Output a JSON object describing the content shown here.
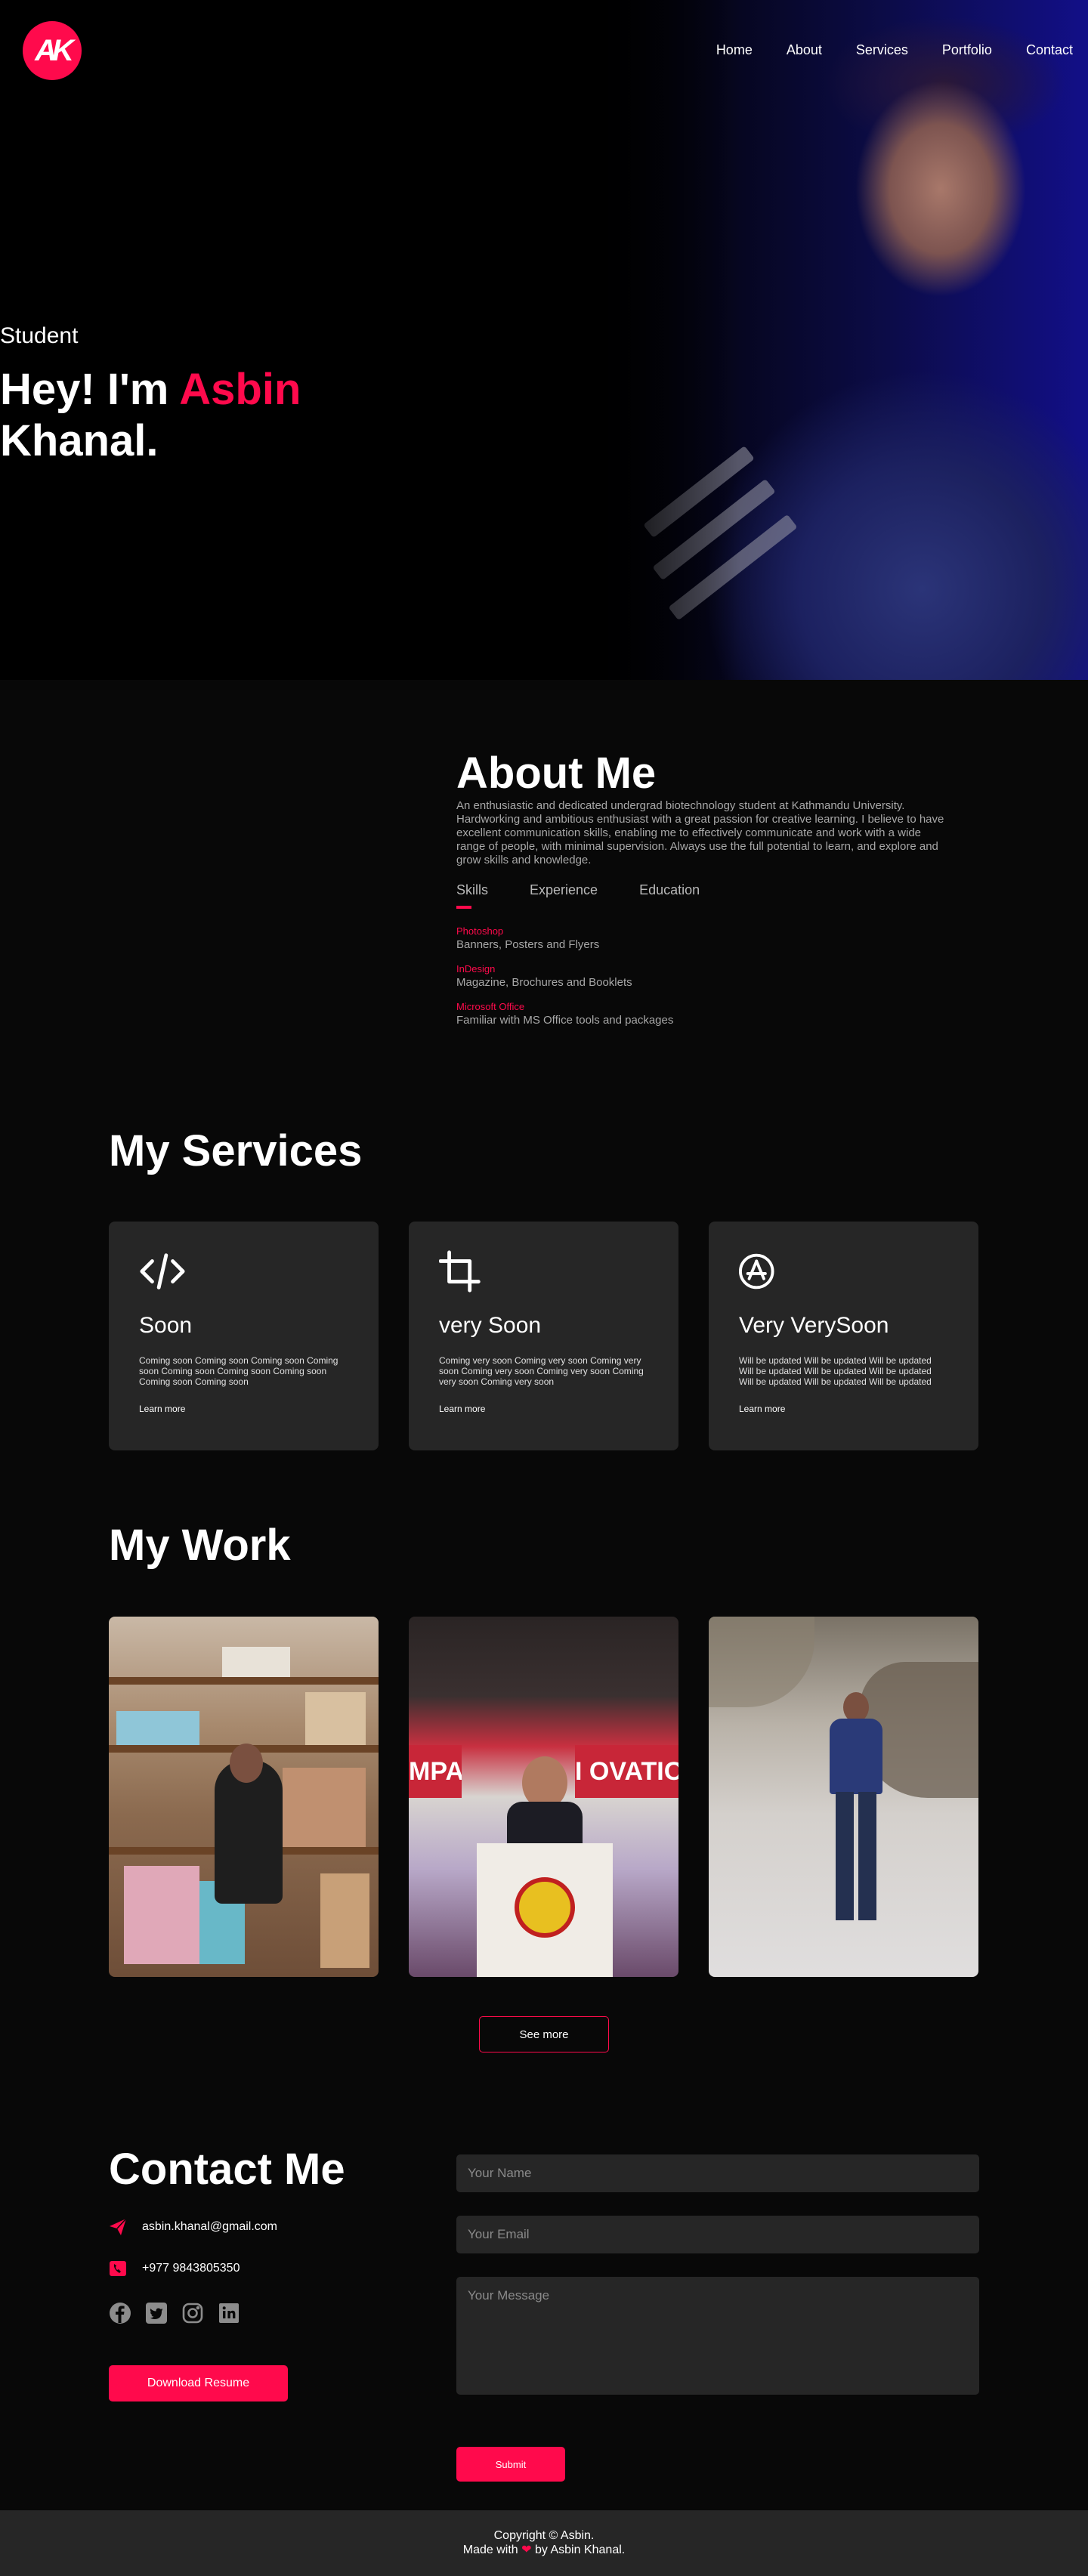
{
  "brand": {
    "logo_text": "AK",
    "accent": "#ff0a4c"
  },
  "nav": [
    {
      "label": "Home"
    },
    {
      "label": "About"
    },
    {
      "label": "Services"
    },
    {
      "label": "Portfolio"
    },
    {
      "label": "Contact"
    }
  ],
  "hero": {
    "subtitle": "Student",
    "greeting": "Hey! I'm",
    "first_name": "Asbin",
    "last_name": "Khanal."
  },
  "about": {
    "title": "About Me",
    "description": "An enthusiastic and dedicated undergrad biotechnology student at Kathmandu University. Hardworking and ambitious enthusiast with a great passion for creative learning. I believe to have excellent communication skills, enabling me to effectively communicate and work with a wide range of people, with minimal supervision. Always use the full potential to learn, and explore and grow skills and knowledge.",
    "tabs": [
      {
        "label": "Skills",
        "active": true
      },
      {
        "label": "Experience",
        "active": false
      },
      {
        "label": "Education",
        "active": false
      }
    ],
    "skills": [
      {
        "name": "Photoshop",
        "value": "Banners, Posters and Flyers"
      },
      {
        "name": "InDesign",
        "value": "Magazine, Brochures and Booklets"
      },
      {
        "name": "Microsoft Office",
        "value": "Familiar with MS Office tools and packages"
      }
    ]
  },
  "services": {
    "title": "My Services",
    "cards": [
      {
        "icon": "code-icon",
        "title": "Soon",
        "text": "Coming soon Coming soon Coming soon Coming soon Coming soon Coming soon Coming soon Coming soon Coming soon",
        "link": "Learn more"
      },
      {
        "icon": "crop-icon",
        "title": "very Soon",
        "text": "Coming very soon Coming very soon Coming very soon Coming very soon Coming very soon Coming very soon Coming very soon",
        "link": "Learn more"
      },
      {
        "icon": "app-store-icon",
        "title": "Very VerySoon",
        "text": "Will be updated Will be updated Will be updated Will be updated Will be updated Will be updated Will be updated Will be updated Will be updated",
        "link": "Learn more"
      }
    ]
  },
  "work": {
    "title": "My Work",
    "see_more": "See more",
    "banner_text_left": "MPACT",
    "banner_text_right": "I  OVATION"
  },
  "contact": {
    "title": "Contact Me",
    "email": "asbin.khanal@gmail.com",
    "phone": "+977 9843805350",
    "socials": [
      "facebook-icon",
      "twitter-icon",
      "instagram-icon",
      "linkedin-icon"
    ],
    "download_label": "Download Resume",
    "name_placeholder": "Your Name",
    "email_placeholder": "Your Email",
    "message_placeholder": "Your Message",
    "submit_label": "Submit"
  },
  "footer": {
    "copyright": "Copyright © Asbin.",
    "made_with": "Made with",
    "by": "by Asbin Khanal."
  }
}
